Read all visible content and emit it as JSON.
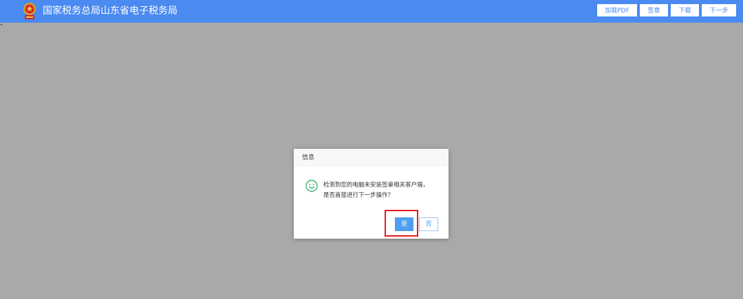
{
  "header": {
    "title": "国家税务总局山东省电子税务局",
    "logo_icon": "tax-emblem-icon",
    "actions": {
      "load_pdf": "加载PDF",
      "sign": "签章",
      "download": "下载",
      "next": "下一步"
    }
  },
  "dialog": {
    "title": "信息",
    "icon": "smiley-icon",
    "message_line1": "检测到您的电脑未安装签章相关客户端，",
    "message_line2": "是否直接进行下一步操作？",
    "yes_label": "是",
    "no_label": "否"
  },
  "colors": {
    "header_bg": "#4b8af0",
    "overlay_bg": "#a9a9a9",
    "primary_button": "#4e9ff0",
    "highlight": "#e5191a",
    "icon_green": "#3cb371"
  }
}
